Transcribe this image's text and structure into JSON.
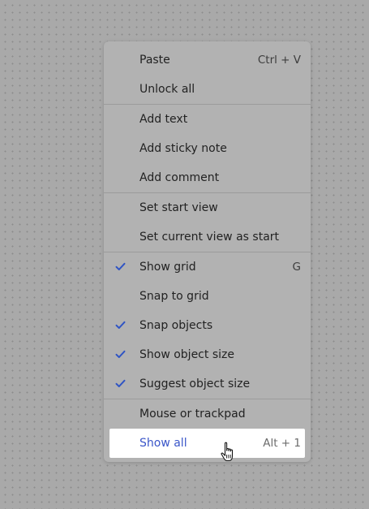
{
  "colors": {
    "canvas_background": "#a9a9a9",
    "menu_background": "#b2b2b2",
    "check_color": "#2f54c4",
    "highlight_background": "#ffffff",
    "highlight_text": "#3a56c9"
  },
  "menu": {
    "paste": {
      "label": "Paste",
      "shortcut": "Ctrl + V"
    },
    "unlock_all": {
      "label": "Unlock all"
    },
    "add_text": {
      "label": "Add text"
    },
    "add_sticky_note": {
      "label": "Add sticky note"
    },
    "add_comment": {
      "label": "Add comment"
    },
    "set_start_view": {
      "label": "Set start view"
    },
    "set_current_view_as_start": {
      "label": "Set current view as start"
    },
    "show_grid": {
      "label": "Show grid",
      "shortcut": "G",
      "checked": true
    },
    "snap_to_grid": {
      "label": "Snap to grid",
      "checked": false
    },
    "snap_objects": {
      "label": "Snap objects",
      "checked": true
    },
    "show_object_size": {
      "label": "Show object size",
      "checked": true
    },
    "suggest_object_size": {
      "label": "Suggest object size",
      "checked": true
    },
    "mouse_or_trackpad": {
      "label": "Mouse or trackpad"
    },
    "show_all": {
      "label": "Show all",
      "shortcut": "Alt + 1",
      "highlighted": true
    }
  },
  "icons": {
    "check": "check-icon",
    "cursor": "hand-pointer-cursor-icon"
  }
}
